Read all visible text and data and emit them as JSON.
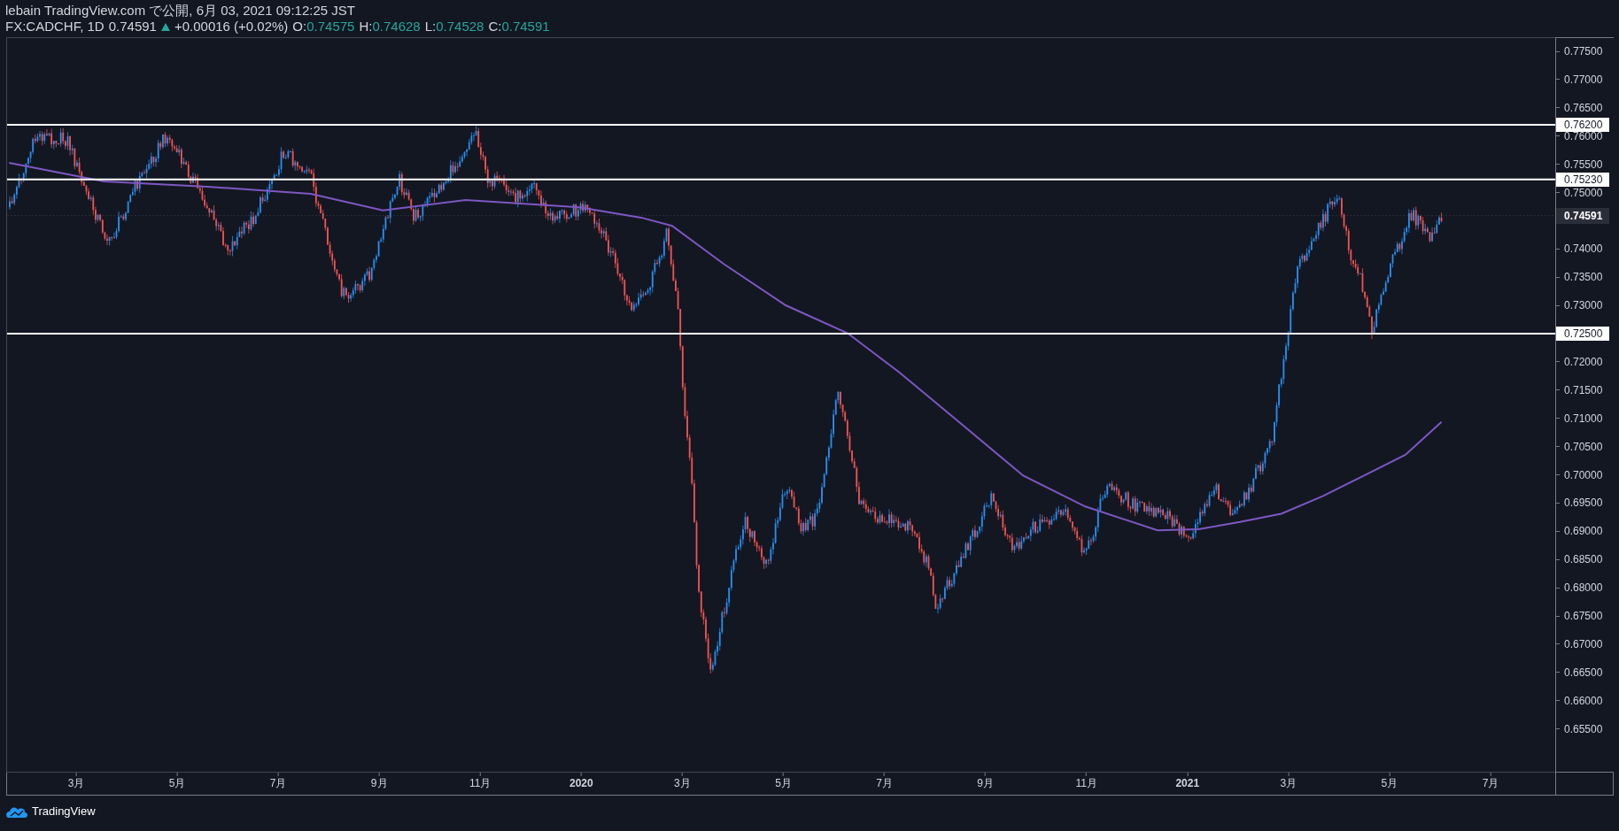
{
  "header": {
    "line1": "lebain TradingView.com で公開, 6月 03, 2021 09:12:25 JST",
    "symbol": "FX:CADCHF, 1D",
    "last": "0.74591",
    "up": true,
    "change": "+0.00016 (+0.02%)",
    "ohlc": [
      {
        "key": "O:",
        "value": "0.74575"
      },
      {
        "key": "H:",
        "value": "0.74628"
      },
      {
        "key": "L:",
        "value": "0.74528"
      },
      {
        "key": "C:",
        "value": "0.74591"
      }
    ]
  },
  "chart": {
    "price_ticks": [
      "0.77500",
      "0.77000",
      "0.76500",
      "0.76000",
      "0.75500",
      "0.75000",
      "0.74000",
      "0.73500",
      "0.73000",
      "0.72000",
      "0.71500",
      "0.71000",
      "0.70500",
      "0.70000",
      "0.69500",
      "0.69000",
      "0.68500",
      "0.68000",
      "0.67500",
      "0.67000",
      "0.66500",
      "0.66000",
      "0.65500"
    ],
    "levels": [
      {
        "label": "0.76200"
      },
      {
        "label": "0.75230"
      },
      {
        "label": "0.72500"
      }
    ],
    "current_price": "0.74591",
    "time_labels": [
      {
        "label": "3月",
        "kind": "month"
      },
      {
        "label": "5月",
        "kind": "month"
      },
      {
        "label": "7月",
        "kind": "month"
      },
      {
        "label": "9月",
        "kind": "month"
      },
      {
        "label": "11月",
        "kind": "month"
      },
      {
        "label": "2020",
        "kind": "year"
      },
      {
        "label": "3月",
        "kind": "month"
      },
      {
        "label": "5月",
        "kind": "month"
      },
      {
        "label": "7月",
        "kind": "month"
      },
      {
        "label": "9月",
        "kind": "month"
      },
      {
        "label": "11月",
        "kind": "month"
      },
      {
        "label": "2021",
        "kind": "year"
      },
      {
        "label": "3月",
        "kind": "month"
      },
      {
        "label": "5月",
        "kind": "month"
      },
      {
        "label": "7月",
        "kind": "month"
      }
    ]
  },
  "footer": {
    "brand": "TradingView"
  }
}
